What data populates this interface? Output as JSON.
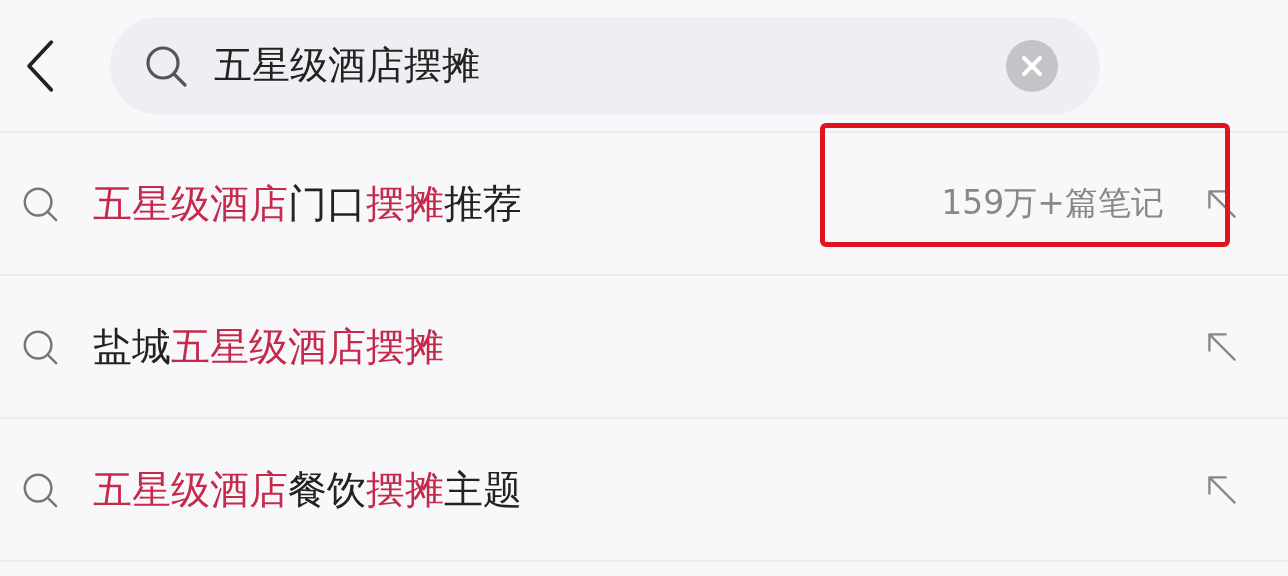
{
  "search": {
    "value": "五星级酒店摆摊"
  },
  "suggestions": [
    {
      "parts": [
        {
          "text": "五星级酒店",
          "highlight": true
        },
        {
          "text": "门口",
          "highlight": false
        },
        {
          "text": "摆摊",
          "highlight": true
        },
        {
          "text": "推荐",
          "highlight": false
        }
      ],
      "count": "159万+篇笔记",
      "marked": true
    },
    {
      "parts": [
        {
          "text": "盐城",
          "highlight": false
        },
        {
          "text": "五星级酒店摆摊",
          "highlight": true
        }
      ],
      "marked": false
    },
    {
      "parts": [
        {
          "text": "五星级酒店",
          "highlight": true
        },
        {
          "text": "餐饮",
          "highlight": false
        },
        {
          "text": "摆摊",
          "highlight": true
        },
        {
          "text": "主题",
          "highlight": false
        }
      ],
      "marked": false
    }
  ]
}
